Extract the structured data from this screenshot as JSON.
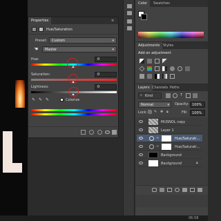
{
  "properties": {
    "tab": "Properties",
    "adjustment_title": "Hue/Saturation",
    "preset_label": "Preset:",
    "preset_value": "Custom",
    "channel_value": "Master",
    "hue_label": "Hue:",
    "hue_value": "0",
    "saturation_label": "Saturation:",
    "saturation_value": "0",
    "lightness_label": "Lightness:",
    "lightness_value": "0",
    "colorize_label": "Colorize"
  },
  "color_panel": {
    "tabs": [
      "Color",
      "Swatches"
    ]
  },
  "adjustments_panel": {
    "tabs": [
      "Adjustments",
      "Styles"
    ],
    "heading": "Add an adjustment"
  },
  "layers_panel": {
    "tabs": [
      "Layers",
      "Channels",
      "Paths"
    ],
    "filter_value": "Kind",
    "blend_mode": "Normal",
    "opacity_label": "Opacity:",
    "opacity_value": "100%",
    "lock_label": "Lock:",
    "fill_label": "Fill:",
    "fill_value": "100%",
    "layers": [
      {
        "name": "MUSNOL copy"
      },
      {
        "name": "Layer 1"
      },
      {
        "name": "Hue/Saturati..."
      },
      {
        "name": "Hue/Saturati..."
      },
      {
        "name": "Background"
      },
      {
        "name": "Background"
      }
    ]
  },
  "status": {
    "zoom_hint": "06:58"
  }
}
